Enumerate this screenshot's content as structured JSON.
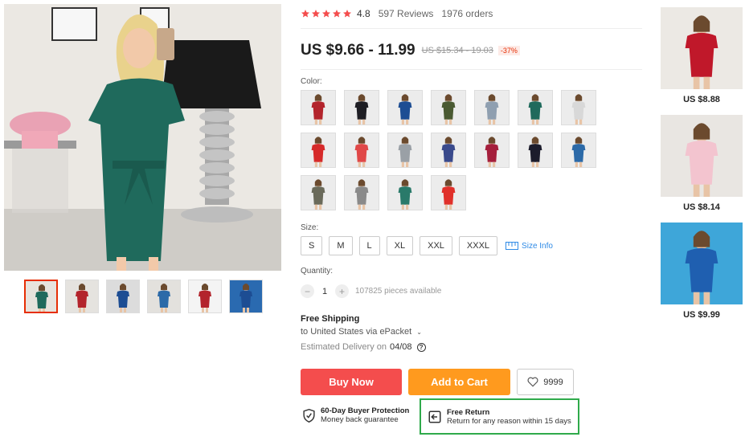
{
  "rating": {
    "score": "4.8",
    "reviews": "597 Reviews",
    "orders": "1976 orders",
    "stars": 5,
    "star_color": "#f44d4d"
  },
  "price": {
    "current": "US $9.66 - 11.99",
    "original": "US $15.34 - 19.03",
    "discount": "-37%"
  },
  "color_section": {
    "label": "Color:",
    "swatch_colors": [
      "#b3242c",
      "#1e1e24",
      "#1d4d93",
      "#4a5a32",
      "#8f9fb0",
      "#1f6a5c",
      "#d8d8d8",
      "#d62a2a",
      "#e04848",
      "#9aa0a6",
      "#3a4a8c",
      "#a51f3c",
      "#1c1c2c",
      "#2c6aa8",
      "#6a6a5a",
      "#8a8a8a",
      "#2a7a6a",
      "#e0302a"
    ]
  },
  "size_section": {
    "label": "Size:",
    "options": [
      "S",
      "M",
      "L",
      "XL",
      "XXL",
      "XXXL"
    ],
    "size_info": "Size Info"
  },
  "quantity": {
    "label": "Quantity:",
    "value": "1",
    "available": "107825 pieces available",
    "minus": "−",
    "plus": "+"
  },
  "shipping": {
    "title": "Free Shipping",
    "to": "to United States via ePacket",
    "estimated_label": "Estimated Delivery on",
    "date": "04/08",
    "help": "?"
  },
  "actions": {
    "buy_now": "Buy Now",
    "add_to_cart": "Add to Cart",
    "wishlist_count": "9999"
  },
  "guarantees": {
    "protection_title": "60-Day Buyer Protection",
    "protection_sub": "Money back guarantee",
    "return_title": "Free Return",
    "return_sub": "Return for any reason within 15 days"
  },
  "recommendations": [
    {
      "price": "US $8.88",
      "dress_color": "#c0182a",
      "bg": "#ece9e4"
    },
    {
      "price": "US $8.14",
      "dress_color": "#f3c4cf",
      "bg": "#e9e6e2"
    },
    {
      "price": "US $9.99",
      "dress_color": "#1f5fb0",
      "bg": "#3ea6d9"
    }
  ],
  "thumbnails": [
    {
      "dress_color": "#1f6a5c",
      "bg": "#e7e3dd"
    },
    {
      "dress_color": "#b3242c",
      "bg": "#e5e3df"
    },
    {
      "dress_color": "#1d4d93",
      "bg": "#dcdcdc"
    },
    {
      "dress_color": "#2c6aa8",
      "bg": "#e3e1dd"
    },
    {
      "dress_color": "#b3242c",
      "bg": "#f4f4f4"
    },
    {
      "dress_color": "#1d4d93",
      "bg": "#2a6ab0"
    }
  ],
  "colors": {
    "accent": "#e62e04",
    "buy": "#f44d4d",
    "cart": "#ff9a1e",
    "highlight": "#2faa4b",
    "link": "#2e8ae6"
  }
}
